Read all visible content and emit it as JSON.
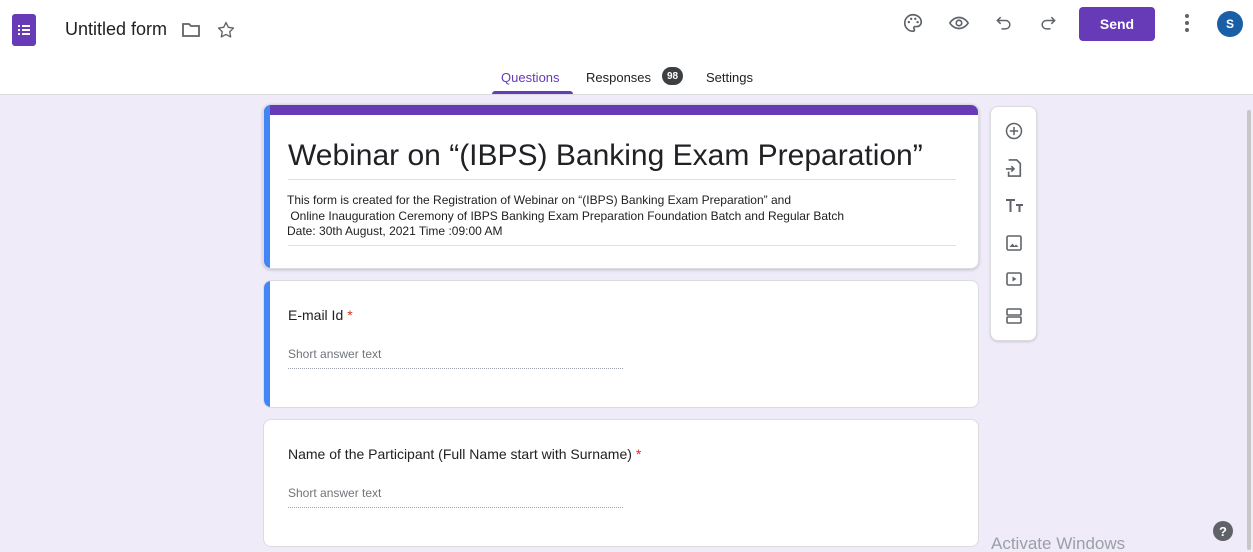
{
  "header": {
    "title": "Untitled form",
    "send_label": "Send",
    "avatar_initial": "S",
    "icons": [
      "forms-logo-icon",
      "folder-icon",
      "star-icon",
      "palette-icon",
      "preview-eye-icon",
      "undo-icon",
      "redo-icon",
      "more-vert-icon"
    ]
  },
  "tabs": {
    "questions": "Questions",
    "responses": "Responses",
    "responses_count": "98",
    "settings": "Settings"
  },
  "form": {
    "title": "Webinar on “(IBPS) Banking Exam Preparation”",
    "description": "This form is created for the Registration of Webinar on “(IBPS) Banking Exam Preparation” and\n Online Inauguration Ceremony of IBPS Banking Exam Preparation Foundation Batch and Regular Batch\nDate: 30th August, 2021 Time :09:00 AM"
  },
  "questions": [
    {
      "label": "E-mail Id",
      "required_mark": "*",
      "placeholder": "Short answer text"
    },
    {
      "label": "Name of the Participant (Full Name start with Surname)",
      "required_mark": "*",
      "placeholder": "Short answer text"
    }
  ],
  "toolbar": {
    "items": [
      "add-question-icon",
      "import-questions-icon",
      "add-title-icon",
      "add-image-icon",
      "add-video-icon",
      "add-section-icon"
    ]
  },
  "os": {
    "watermark": "Activate Windows",
    "help_glyph": "?"
  },
  "colors": {
    "accent": "#673ab7",
    "focus": "#4285f4",
    "background": "#f0ebf8",
    "required": "#d93025"
  }
}
